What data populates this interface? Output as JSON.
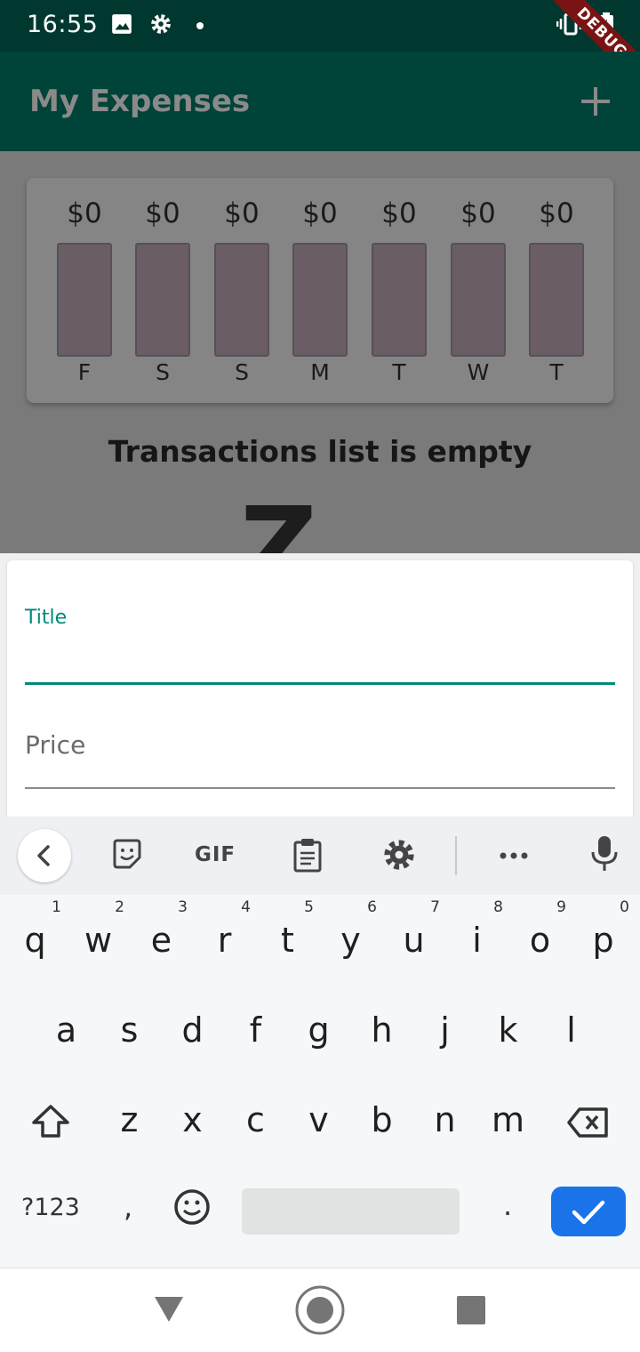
{
  "status_bar": {
    "time": "16:55",
    "debug_label": "DEBUG"
  },
  "app_bar": {
    "title": "My Expenses",
    "add_icon": "plus-icon"
  },
  "chart": {
    "days": [
      {
        "amount": "$0",
        "label": "F"
      },
      {
        "amount": "$0",
        "label": "S"
      },
      {
        "amount": "$0",
        "label": "S"
      },
      {
        "amount": "$0",
        "label": "M"
      },
      {
        "amount": "$0",
        "label": "T"
      },
      {
        "amount": "$0",
        "label": "W"
      },
      {
        "amount": "$0",
        "label": "T"
      }
    ]
  },
  "empty_state": {
    "text": "Transactions list is empty",
    "glyph": "Z"
  },
  "form": {
    "title_label": "Title",
    "title_value": "",
    "price_placeholder": "Price"
  },
  "keyboard": {
    "toolbar": {
      "gif_label": "GIF"
    },
    "row1": [
      {
        "k": "q",
        "h": "1"
      },
      {
        "k": "w",
        "h": "2"
      },
      {
        "k": "e",
        "h": "3"
      },
      {
        "k": "r",
        "h": "4"
      },
      {
        "k": "t",
        "h": "5"
      },
      {
        "k": "y",
        "h": "6"
      },
      {
        "k": "u",
        "h": "7"
      },
      {
        "k": "i",
        "h": "8"
      },
      {
        "k": "o",
        "h": "9"
      },
      {
        "k": "p",
        "h": "0"
      }
    ],
    "row2": [
      "a",
      "s",
      "d",
      "f",
      "g",
      "h",
      "j",
      "k",
      "l"
    ],
    "row3": [
      "z",
      "x",
      "c",
      "v",
      "b",
      "n",
      "m"
    ],
    "symbols_label": "?123",
    "comma": ",",
    "period": "."
  },
  "colors": {
    "primary": "#004338",
    "status": "#00382f",
    "accent": "#00897b",
    "done": "#1a73e8"
  }
}
